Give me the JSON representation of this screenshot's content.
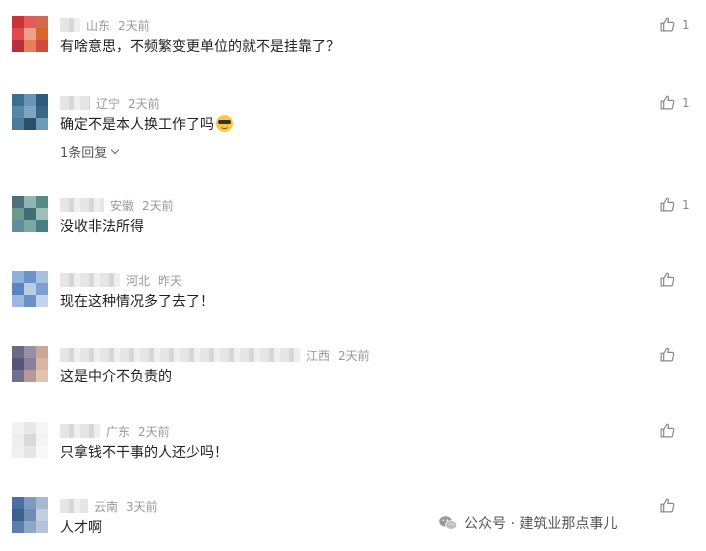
{
  "colors": {
    "meta_text": "#999999",
    "body_text": "#222222"
  },
  "comments": [
    {
      "location": "山东",
      "time": "2天前",
      "text": "有啥意思，不频繁变更单位的就不是挂靠了？",
      "likes": "1",
      "avatar": [
        "#c9333a",
        "#e35b5b",
        "#d46a4d",
        "#e04a4a",
        "#f0a08a",
        "#d9662b",
        "#b82e3c",
        "#ea7d59",
        "#cf4b3f"
      ]
    },
    {
      "location": "辽宁",
      "time": "2天前",
      "text": "确定不是本人换工作了吗",
      "emoji": "sunglasses-emoji",
      "reply_label": "1条回复",
      "likes": "1",
      "avatar": [
        "#3b6f8e",
        "#6a96b3",
        "#2f5a78",
        "#5388a8",
        "#7aa6c2",
        "#3a6685",
        "#4b7c9c",
        "#2a4f6b",
        "#6d9bb6"
      ]
    },
    {
      "location": "安徽",
      "time": "2天前",
      "text": "没收非法所得",
      "likes": "1",
      "avatar": [
        "#4f6f7a",
        "#8fb6b0",
        "#5a8a86",
        "#6d9a8e",
        "#3f6e77",
        "#9cc0b8",
        "#5f8f9e",
        "#7aa8a2",
        "#4a7d85"
      ]
    },
    {
      "location": "河北",
      "time": "昨天",
      "text": "现在这种情况多了去了！",
      "likes": "",
      "avatar": [
        "#8fb0d8",
        "#6d94c9",
        "#a6c0e0",
        "#5a86c0",
        "#b8cde6",
        "#7e9fd0",
        "#9cb8dc",
        "#6a90c6",
        "#c2d4ea"
      ]
    },
    {
      "location": "江西",
      "time": "2天前",
      "text": "这是中介不负责的",
      "likes": "",
      "avatar": [
        "#6b6b88",
        "#9a8fa8",
        "#c8a89a",
        "#55557a",
        "#8a7f9c",
        "#d6b6a2",
        "#70708e",
        "#b59a96",
        "#e0c4b0"
      ]
    },
    {
      "location": "广东",
      "time": "2天前",
      "text": "只拿钱不干事的人还少吗！",
      "likes": "",
      "avatar": [
        "#f2f2f2",
        "#e8e8e8",
        "#f6f6f6",
        "#eeeeee",
        "#d9d9d9",
        "#f4f4f4",
        "#f0f0f0",
        "#e6e6e6",
        "#f8f8f8"
      ]
    },
    {
      "location": "云南",
      "time": "3天前",
      "text": "人才啊",
      "likes": "",
      "avatar": [
        "#4a6fa0",
        "#7f9cc0",
        "#a9b8cf",
        "#3d5f8f",
        "#6d8db6",
        "#c3cfe0",
        "#5b7eaa",
        "#8ea8c8",
        "#b5c3d8"
      ]
    }
  ],
  "watermark": {
    "icon": "wechat-icon",
    "text": "公众号 · 建筑业那点事儿"
  }
}
